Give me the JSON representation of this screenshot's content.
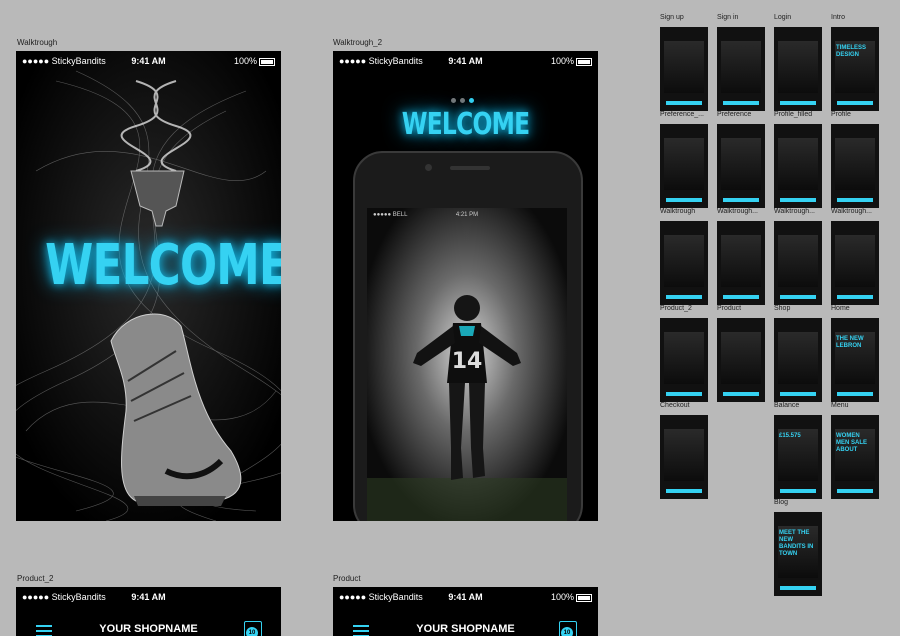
{
  "artboards": {
    "walkthrough": {
      "label": "Walktrough",
      "carrier": "●●●●● StickyBandits",
      "time": "9:41 AM",
      "battery": "100%",
      "headline": "WELCOME"
    },
    "walkthrough2": {
      "label": "Walktrough_2",
      "carrier": "●●●●● StickyBandits",
      "time": "9:41 AM",
      "battery": "100%",
      "headline": "WELCOME",
      "inner_carrier": "●●●●● BELL",
      "inner_time": "4:21 PM",
      "jersey_number": "14"
    },
    "product2": {
      "label": "Product_2",
      "carrier": "●●●●● StickyBandits",
      "time": "9:41 AM",
      "title": "YOUR SHOPNAME",
      "cart_count": "10"
    },
    "product": {
      "label": "Product",
      "carrier": "●●●●● StickyBandits",
      "time": "9:41 AM",
      "battery": "100%",
      "title": "YOUR SHOPNAME",
      "cart_count": "10"
    }
  },
  "thumbnails": [
    {
      "label": "Sign up"
    },
    {
      "label": "Sign in"
    },
    {
      "label": "Login"
    },
    {
      "label": "Intro",
      "text": "TIMELESS DESIGN"
    },
    {
      "label": "Preference_..."
    },
    {
      "label": "Preference"
    },
    {
      "label": "Profile_filled"
    },
    {
      "label": "Profile"
    },
    {
      "label": "Walktrough"
    },
    {
      "label": "Walktrough..."
    },
    {
      "label": "Walktrough..."
    },
    {
      "label": "Walktrough..."
    },
    {
      "label": "Product_2"
    },
    {
      "label": "Product"
    },
    {
      "label": "Shop"
    },
    {
      "label": "Home",
      "text": "THE NEW LEBRON"
    },
    {
      "label": "Checkout"
    },
    {
      "label": "Balance",
      "text": "£15.575"
    },
    {
      "label": "Menu",
      "text": "WOMEN MEN SALE ABOUT"
    },
    {
      "label": "Blog",
      "text": "MEET THE NEW BANDITS IN TOWN"
    }
  ],
  "colors": {
    "accent": "#35d2f2",
    "canvas": "#b9b9b9",
    "screen": "#000000"
  }
}
